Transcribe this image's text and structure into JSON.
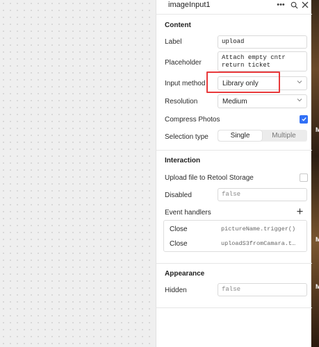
{
  "panel": {
    "title": "imageInput1",
    "header_icons": [
      "more-icon",
      "search-icon",
      "close-icon"
    ]
  },
  "content": {
    "section_title": "Content",
    "label": {
      "label": "Label",
      "value": "upload"
    },
    "placeholder": {
      "label": "Placeholder",
      "value": "Attach empty cntr return ticket"
    },
    "input_method": {
      "label": "Input method",
      "value": "Library only"
    },
    "resolution": {
      "label": "Resolution",
      "value": "Medium"
    },
    "compress_photos": {
      "label": "Compress Photos",
      "checked": true
    },
    "selection_type": {
      "label": "Selection type",
      "options": [
        "Single",
        "Multiple"
      ],
      "selected": "Single"
    }
  },
  "interaction": {
    "section_title": "Interaction",
    "upload_storage": {
      "label": "Upload file to Retool Storage",
      "checked": false
    },
    "disabled": {
      "label": "Disabled",
      "value": "false"
    },
    "event_handlers": {
      "label": "Event handlers",
      "items": [
        {
          "event": "Close",
          "action": "pictureName.trigger()"
        },
        {
          "event": "Close",
          "action": "uploadS3fromCamara.t…"
        }
      ]
    }
  },
  "appearance": {
    "section_title": "Appearance",
    "hidden": {
      "label": "Hidden",
      "value": "false"
    }
  },
  "colors": {
    "accent": "#3170f6",
    "highlight": "#e8393b"
  }
}
